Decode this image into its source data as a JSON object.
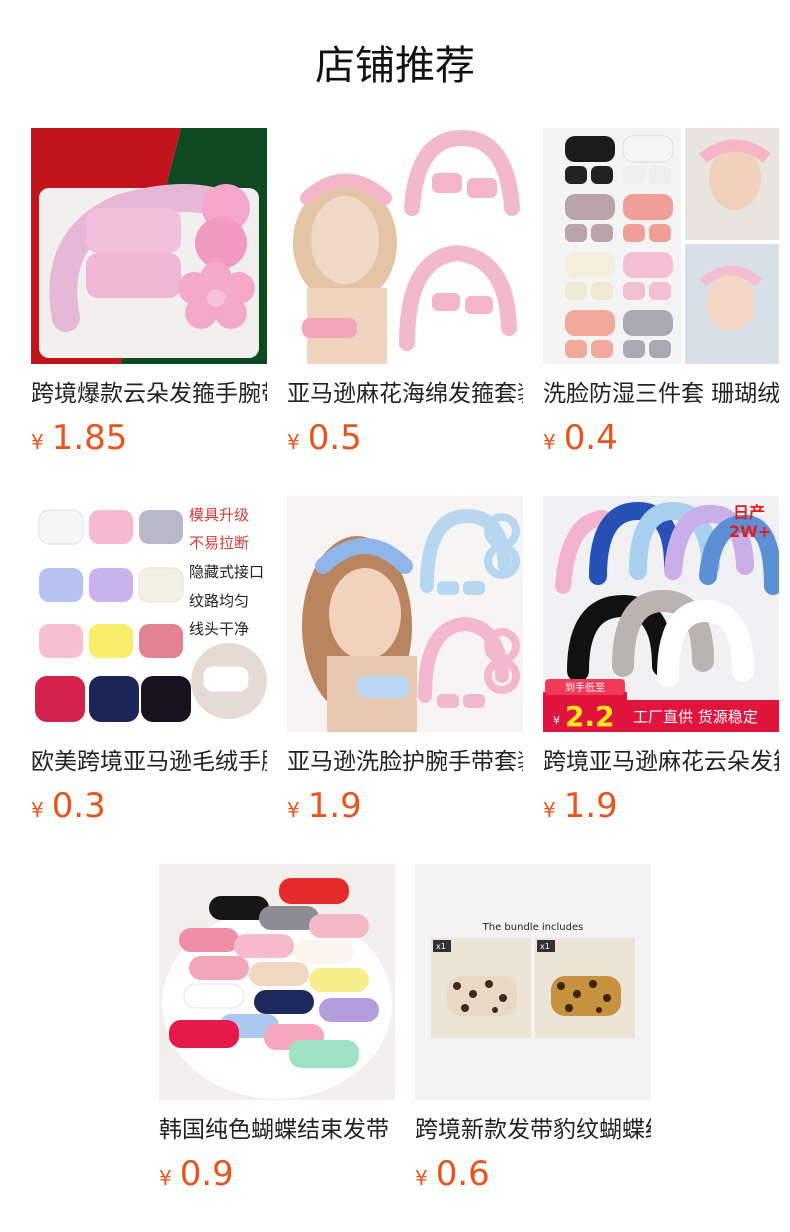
{
  "page": {
    "title": "店铺推荐"
  },
  "currency_symbol": "¥",
  "products": [
    {
      "name": "跨境爆款云朵发箍手腕带套装",
      "price": "1.85",
      "icon": "pink-headband-set-image"
    },
    {
      "name": "亚马逊麻花海绵发箍套装",
      "price": "0.5",
      "icon": "model-headband-image"
    },
    {
      "name": "洗脸防湿三件套 珊瑚绒",
      "price": "0.4",
      "icon": "bow-headband-grid-image"
    },
    {
      "name": "欧美跨境亚马逊毛绒手腕带",
      "price": "0.3",
      "icon": "wristband-colors-image",
      "overlay": [
        "模具升级",
        "不易拉断",
        "隐藏式接口",
        "纹路均匀",
        "线头干净"
      ]
    },
    {
      "name": "亚马逊洗脸护腕手带套装",
      "price": "1.9",
      "icon": "blue-pink-headband-image"
    },
    {
      "name": "跨境亚马逊麻花云朵发箍",
      "price": "1.9",
      "icon": "colorful-headbands-image",
      "overlay": {
        "daily": "日产",
        "volume": "2W+",
        "promo_top": "到手低至",
        "promo_cur": "¥",
        "promo_price": "2.2",
        "promo_text": "工厂直供 货源稳定"
      }
    },
    {
      "name": "韩国纯色蝴蝶结束发带",
      "price": "0.9",
      "icon": "bow-pile-image"
    },
    {
      "name": "跨境新款发带豹纹蝴蝶结",
      "price": "0.6",
      "icon": "leopard-headband-image",
      "overlay": {
        "heading": "The bundle includes",
        "qty1": "x1",
        "qty2": "x1"
      }
    }
  ]
}
